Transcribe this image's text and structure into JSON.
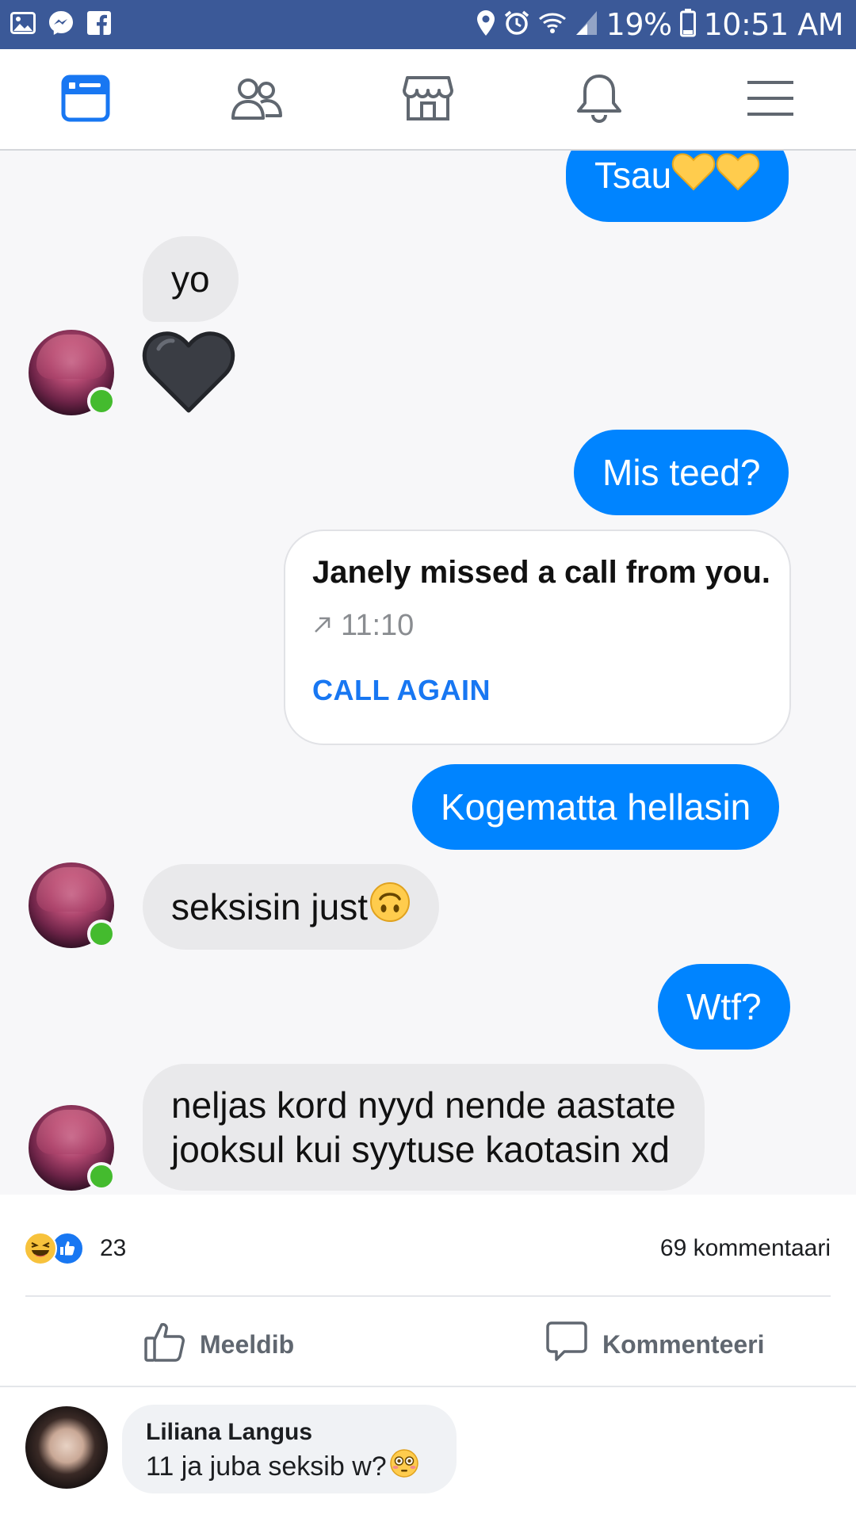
{
  "status_bar": {
    "battery": "19%",
    "time": "10:51 AM"
  },
  "nav": {
    "icons": [
      "news-feed-icon",
      "friends-icon",
      "marketplace-icon",
      "notifications-icon",
      "menu-icon"
    ],
    "active": "news-feed-icon",
    "active_color": "#1877f2"
  },
  "chat": {
    "messages": [
      {
        "from": "me",
        "text": "Tsau",
        "emoji": [
          "yellow-heart",
          "yellow-heart"
        ]
      },
      {
        "from": "them",
        "text": "yo"
      },
      {
        "from": "them",
        "emoji": [
          "black-heart"
        ]
      },
      {
        "from": "me",
        "text": "Mis teed?"
      },
      {
        "from": "me",
        "type": "call"
      },
      {
        "from": "me",
        "text": "Kogematta hellasin"
      },
      {
        "from": "them",
        "text": "seksisin just",
        "emoji": [
          "upside-down-face"
        ]
      },
      {
        "from": "me",
        "text": "Wtf?"
      },
      {
        "from": "them",
        "lines": [
          "neljas kord nyyd nende aastate",
          "jooksul kui syytuse kaotasin xd"
        ]
      }
    ],
    "call_card": {
      "title": "Janely missed a call from you.",
      "time": "11:10",
      "action": "CALL AGAIN"
    },
    "outgoing_color": "#0084ff",
    "incoming_color": "#e9e9eb"
  },
  "reactions": {
    "types": [
      "haha",
      "like"
    ],
    "count": "23",
    "comments": "69 kommentaari"
  },
  "actions": {
    "like": "Meeldib",
    "comment": "Kommenteeri"
  },
  "comment": {
    "author": "Liliana Langus",
    "text": "11 ja juba seksib w?",
    "emoji": "flushed-face"
  }
}
